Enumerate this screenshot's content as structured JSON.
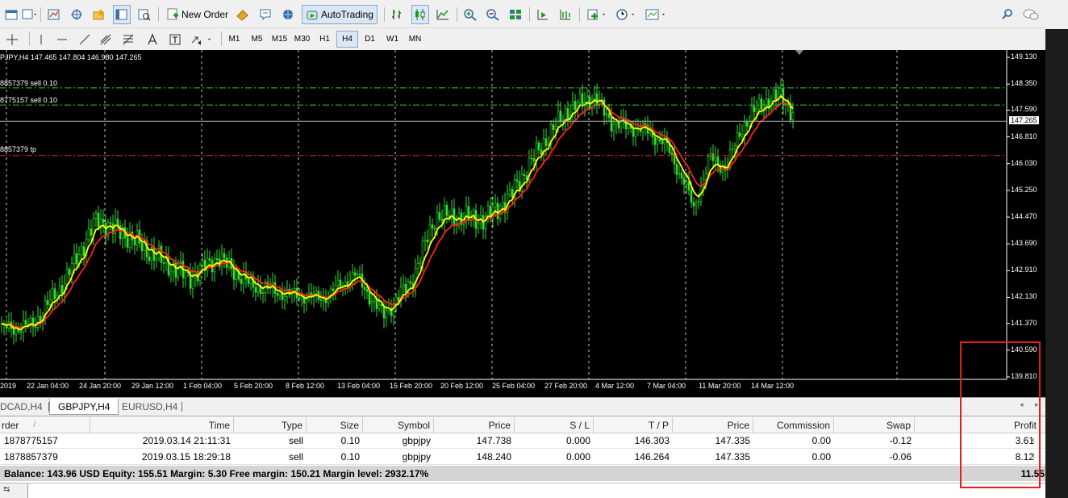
{
  "toolbar": {
    "new_order_label": "New Order",
    "autotrading_label": "AutoTrading",
    "timeframes": [
      "M1",
      "M5",
      "M15",
      "M30",
      "H1",
      "H4",
      "D1",
      "W1",
      "MN"
    ],
    "active_timeframe": "H4"
  },
  "chart": {
    "info_text": "PJPY,H4  147.465 147.804 146.980 147.265",
    "order_lines": [
      {
        "text": "8857379 sell 0.10",
        "price": 148.24,
        "color": "#2ecc2e"
      },
      {
        "text": "8775157 sell 0.10",
        "price": 147.738,
        "color": "#2ecc2e"
      },
      {
        "text": "8857379 tp",
        "price": 146.264,
        "color": "#e02020"
      }
    ],
    "current_price": "147.265",
    "price_axis": [
      "149.130",
      "148.350",
      "147.590",
      "146.810",
      "146.030",
      "145.250",
      "144.470",
      "143.690",
      "142.910",
      "142.130",
      "141.370",
      "140.590",
      "139.810"
    ],
    "time_axis": [
      "2019",
      "22 Jan 04:00",
      "24 Jan 20:00",
      "29 Jan 12:00",
      "1 Feb 04:00",
      "5 Feb 20:00",
      "8 Feb 12:00",
      "13 Feb 04:00",
      "15 Feb 20:00",
      "20 Feb 12:00",
      "25 Feb 04:00",
      "27 Feb 20:00",
      "4 Mar 12:00",
      "7 Mar 04:00",
      "11 Mar 20:00",
      "14 Mar 12:00"
    ],
    "colors": {
      "candles": "#33dd33",
      "fast_ma": "#ffff00",
      "slow_ma": "#ff2020",
      "grid": "#c8c8c8"
    }
  },
  "chart_tabs": [
    {
      "label": "DCAD,H4",
      "active": false
    },
    {
      "label": "GBPJPY,H4",
      "active": true
    },
    {
      "label": "EURUSD,H4",
      "active": false
    }
  ],
  "terminal": {
    "headers": [
      "rder",
      "Time",
      "Type",
      "Size",
      "Symbol",
      "Price",
      "S / L",
      "T / P",
      "Price",
      "Commission",
      "Swap",
      "Profit"
    ],
    "sort_indicator": "/",
    "rows": [
      [
        "1878775157",
        "2019.03.14 21:11:31",
        "sell",
        "0.10",
        "gbpjpy",
        "147.738",
        "0.000",
        "146.303",
        "147.335",
        "0.00",
        "-0.12",
        "3.61"
      ],
      [
        "1878857379",
        "2019.03.15 18:29:18",
        "sell",
        "0.10",
        "gbpjpy",
        "148.240",
        "0.000",
        "146.264",
        "147.335",
        "0.00",
        "-0.06",
        "8.12"
      ]
    ],
    "close_glyph": "×",
    "summary_text": "Balance: 143.96 USD  Equity: 155.51  Margin: 5.30  Free margin: 150.21  Margin level: 2932.17%",
    "summary_profit": "11.55"
  },
  "highlight_color": "#e02020"
}
